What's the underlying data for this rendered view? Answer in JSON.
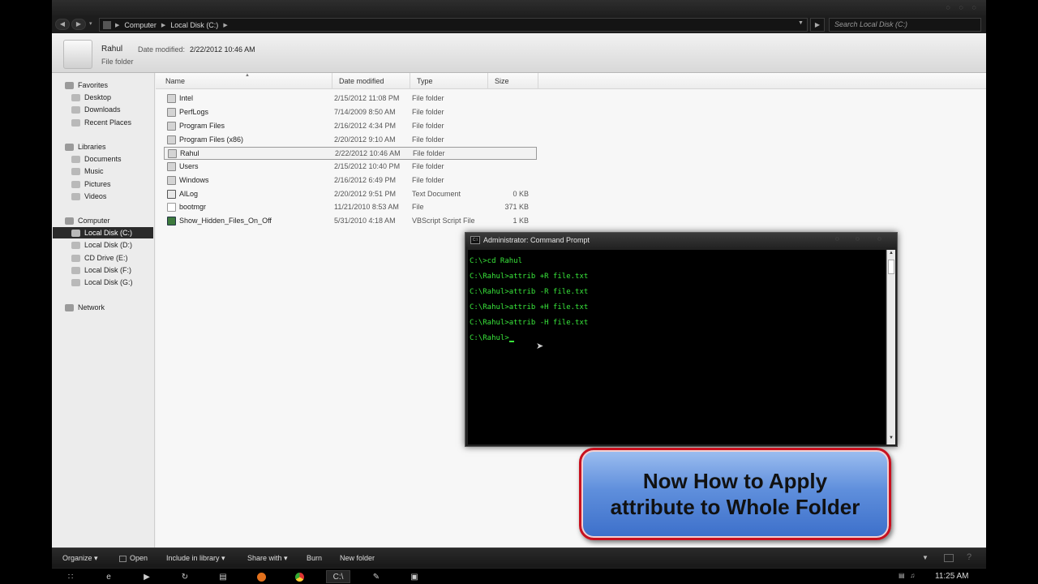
{
  "explorer": {
    "address": {
      "crumbs": [
        "Computer",
        "Local Disk (C:)"
      ],
      "search_placeholder": "Search Local Disk (C:)"
    },
    "details": {
      "name": "Rahul",
      "kind": "File folder",
      "modified_label": "Date modified:",
      "modified_value": "2/22/2012 10:46 AM"
    },
    "nav": {
      "favorites": "Favorites",
      "desktop": "Desktop",
      "downloads": "Downloads",
      "recent": "Recent Places",
      "libraries": "Libraries",
      "documents": "Documents",
      "music": "Music",
      "pictures": "Pictures",
      "videos": "Videos",
      "computer": "Computer",
      "drive_c": "Local Disk (C:)",
      "drive_d": "Local Disk (D:)",
      "drive_e": "CD Drive (E:)",
      "drive_f": "Local Disk (F:)",
      "drive_g": "Local Disk (G:)",
      "network": "Network"
    },
    "columns": {
      "name": "Name",
      "date": "Date modified",
      "type": "Type",
      "size": "Size"
    },
    "files": [
      {
        "name": "Intel",
        "date": "2/15/2012 11:08 PM",
        "type": "File folder",
        "size": ""
      },
      {
        "name": "PerfLogs",
        "date": "7/14/2009 8:50 AM",
        "type": "File folder",
        "size": ""
      },
      {
        "name": "Program Files",
        "date": "2/16/2012 4:34 PM",
        "type": "File folder",
        "size": ""
      },
      {
        "name": "Program Files (x86)",
        "date": "2/20/2012 9:10 AM",
        "type": "File folder",
        "size": ""
      },
      {
        "name": "Rahul",
        "date": "2/22/2012 10:46 AM",
        "type": "File folder",
        "size": ""
      },
      {
        "name": "Users",
        "date": "2/15/2012 10:40 PM",
        "type": "File folder",
        "size": ""
      },
      {
        "name": "Windows",
        "date": "2/16/2012 6:49 PM",
        "type": "File folder",
        "size": ""
      },
      {
        "name": "AlLog",
        "date": "2/20/2012 9:51 PM",
        "type": "Text Document",
        "size": "0 KB"
      },
      {
        "name": "bootmgr",
        "date": "11/21/2010 8:53 AM",
        "type": "File",
        "size": "371 KB"
      },
      {
        "name": "Show_Hidden_Files_On_Off",
        "date": "5/31/2010 4:18 AM",
        "type": "VBScript Script File",
        "size": "1 KB"
      }
    ],
    "toolbar": {
      "organize": "Organize ▾",
      "open": "Open",
      "include": "Include in library ▾",
      "share": "Share with ▾",
      "burn": "Burn",
      "new_folder": "New folder"
    }
  },
  "cmd": {
    "title": "Administrator: Command Prompt",
    "lines": [
      "C:\\>cd Rahul",
      "C:\\Rahul>attrib +R file.txt",
      "C:\\Rahul>attrib -R file.txt",
      "C:\\Rahul>attrib +H file.txt",
      "C:\\Rahul>attrib -H file.txt",
      "C:\\Rahul>"
    ]
  },
  "callout": {
    "text": "Now How to Apply\nattribute to Whole Folder"
  },
  "taskbar": {
    "clock": "11:25 AM"
  },
  "colors": {
    "console_text": "#39e63b",
    "callout_border": "#c8101e",
    "callout_fill": "#5f8fdc"
  }
}
